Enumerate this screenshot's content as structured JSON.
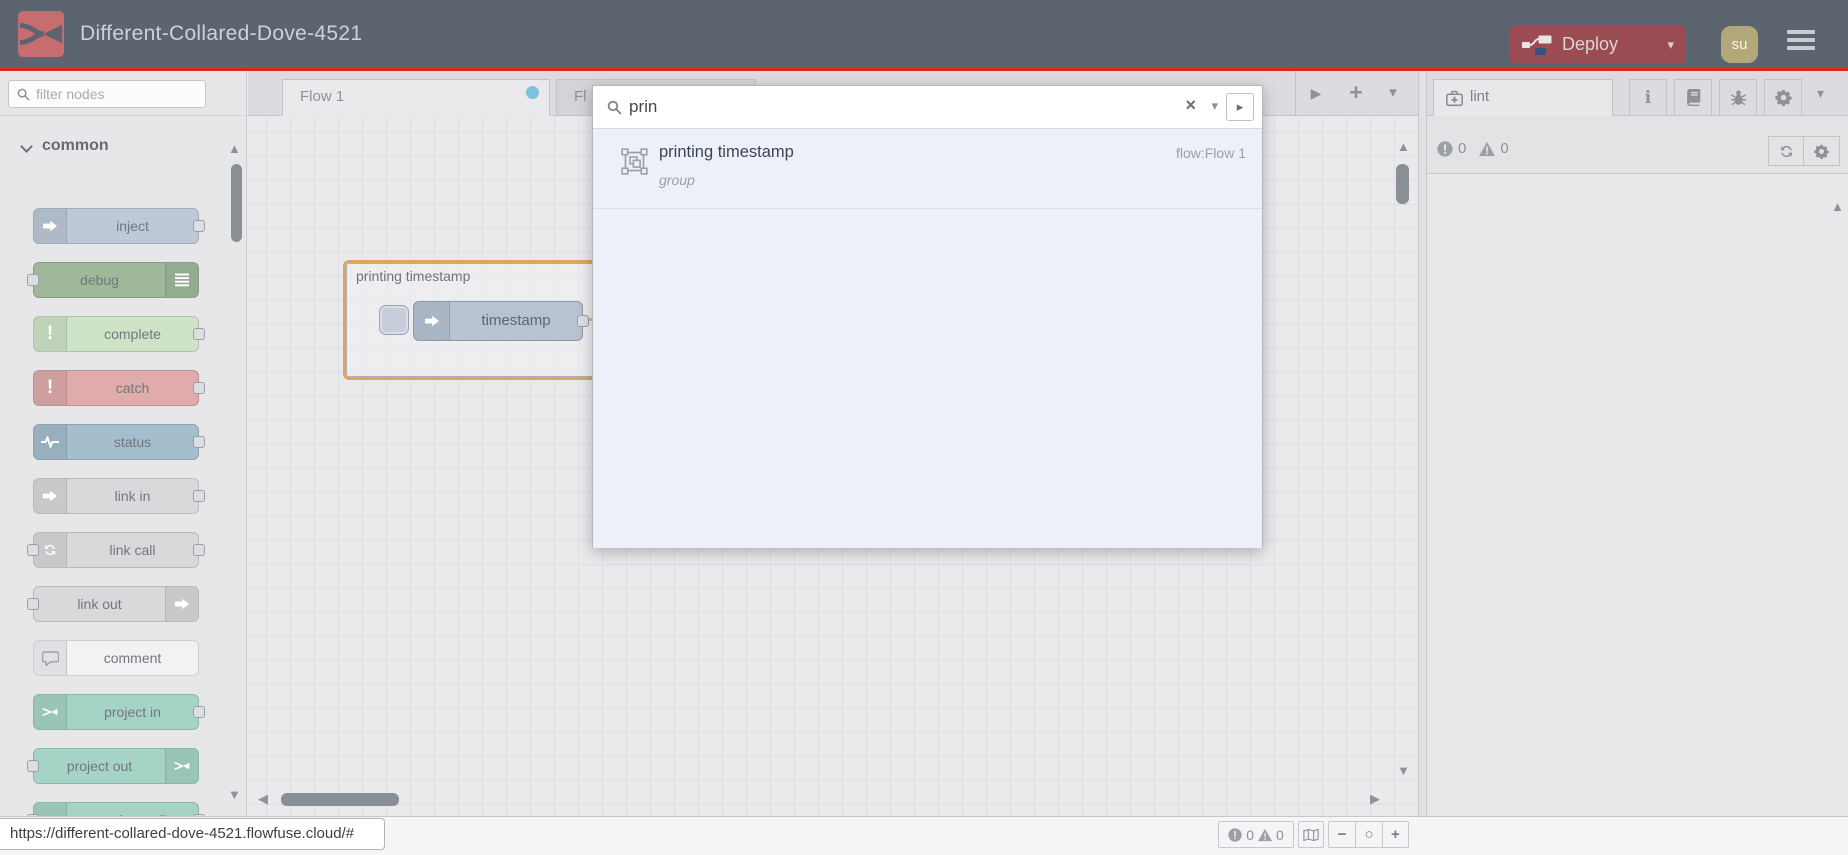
{
  "colors": {
    "accent_red": "#df2420",
    "header_bg": "#5c6470",
    "logo_bg": "#c76d70",
    "deploy_bg": "#9b4b52",
    "avatar_bg": "#b2a87a",
    "modified_dot": "#7cc2dc",
    "group_border": "#dfa55f"
  },
  "icons": {
    "play": "▶",
    "add": "+",
    "caret_down": "▾",
    "caret_right": "▸",
    "clear": "×",
    "scroll_up": "▲",
    "scroll_down": "▼",
    "scroll_left": "◀",
    "scroll_right": "▶",
    "zoom_out": "−",
    "zoom_reset": "○",
    "zoom_in": "+",
    "info": "i"
  },
  "header": {
    "title": "Different-Collared-Dove-4521",
    "deploy_label": "Deploy",
    "avatar_initials": "su"
  },
  "palette": {
    "filter_placeholder": "filter nodes",
    "category": "common",
    "nodes": [
      {
        "label": "inject",
        "color": "#bdc9d8",
        "icon": "inject-arrow-icon",
        "icon_side": "left",
        "ports": "out"
      },
      {
        "label": "debug",
        "color": "#9fb899",
        "icon": "debug-list-icon",
        "icon_side": "right",
        "ports": "in"
      },
      {
        "label": "complete",
        "color": "#cfe3c6",
        "icon": "exclamation-icon",
        "icon_side": "left",
        "ports": "out"
      },
      {
        "label": "catch",
        "color": "#dfabab",
        "icon": "exclamation-icon",
        "icon_side": "left",
        "ports": "out"
      },
      {
        "label": "status",
        "color": "#a4becd",
        "icon": "pulse-icon",
        "icon_side": "left",
        "ports": "out"
      },
      {
        "label": "link in",
        "color": "#d9d9dc",
        "icon": "link-arrow-icon",
        "icon_side": "left",
        "ports": "out"
      },
      {
        "label": "link call",
        "color": "#d9d9dc",
        "icon": "link-call-icon",
        "icon_side": "left",
        "ports": "both"
      },
      {
        "label": "link out",
        "color": "#d9d9dc",
        "icon": "link-arrow-icon",
        "icon_side": "right",
        "ports": "in"
      },
      {
        "label": "comment",
        "color": "#f2f2f4",
        "icon": "comment-icon",
        "icon_side": "left",
        "ports": "none"
      },
      {
        "label": "project in",
        "color": "#a5d4c6",
        "icon": "flowfuse-icon",
        "icon_side": "left",
        "ports": "out"
      },
      {
        "label": "project out",
        "color": "#a5d4c6",
        "icon": "flowfuse-icon",
        "icon_side": "right",
        "ports": "in"
      },
      {
        "label": "project call",
        "color": "#a5d4c6",
        "icon": "flowfuse-icon",
        "icon_side": "left",
        "ports": "both"
      }
    ]
  },
  "workspace": {
    "tabs": [
      {
        "label": "Flow 1",
        "modified": true
      },
      {
        "label": "Fl"
      }
    ],
    "group_label": "printing timestamp",
    "node_label": "timestamp"
  },
  "search": {
    "value": "prin",
    "results": [
      {
        "title": "printing timestamp",
        "type": "group",
        "flow": "flow:Flow 1"
      }
    ]
  },
  "sidebar": {
    "tab_label": "lint",
    "errors": "0",
    "warnings": "0"
  },
  "footer": {
    "url": "https://different-collared-dove-4521.flowfuse.cloud/#",
    "errors": "0",
    "warnings": "0"
  }
}
